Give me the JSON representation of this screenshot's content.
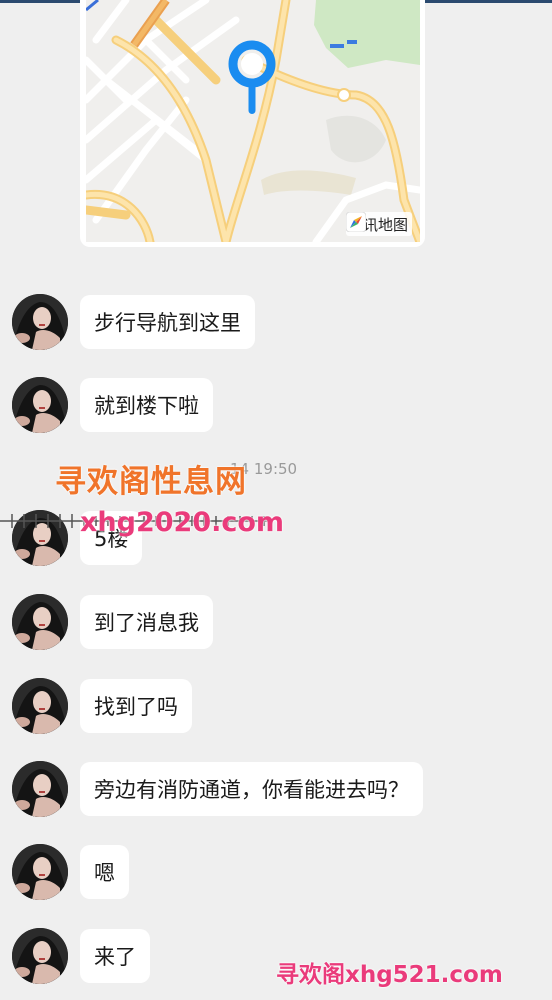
{
  "map": {
    "brand": "腾讯地图",
    "icons": [
      "location-pin-icon",
      "compass-logo-icon"
    ]
  },
  "messages": [
    {
      "text": "步行导航到这里"
    },
    {
      "text": "就到楼下啦"
    },
    {
      "text": "5楼"
    },
    {
      "text": "到了消息我"
    },
    {
      "text": "找到了吗"
    },
    {
      "text": "旁边有消防通道，你看能进去吗？"
    },
    {
      "text": "嗯"
    },
    {
      "text": "来了"
    }
  ],
  "timestamp": "14 19:50",
  "watermarks": {
    "line1": "寻欢阁性息网",
    "line2": "xhg2020.com",
    "line3": "寻欢阁xhg521.com"
  },
  "colors": {
    "background": "#efefef",
    "bubble": "#ffffff",
    "pin": "#1a8cf0",
    "watermark_orange": "#f0742a",
    "watermark_pink": "#ea3b7b"
  }
}
